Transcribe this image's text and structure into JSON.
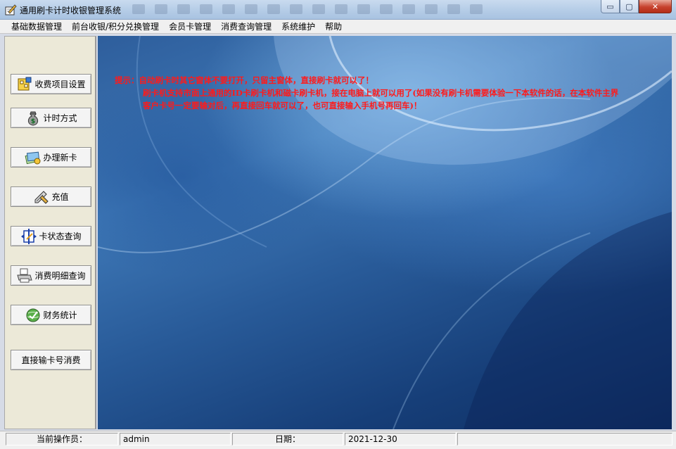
{
  "window": {
    "title": "通用刷卡计时收银管理系统",
    "controls": {
      "minimize": "▭",
      "maximize": "▢",
      "close": "✕"
    }
  },
  "menu": [
    "基础数据管理",
    "前台收银/积分兑换管理",
    "会员卡管理",
    "消费查询管理",
    "系统维护",
    "帮助"
  ],
  "sidebar": {
    "buttons": [
      {
        "label": "收费项目设置",
        "icon": "fee-settings-icon"
      },
      {
        "label": "计时方式",
        "icon": "money-bag-icon"
      },
      {
        "label": "办理新卡",
        "icon": "new-card-icon"
      },
      {
        "label": "充值",
        "icon": "recharge-pen-icon"
      },
      {
        "label": "卡状态查询",
        "icon": "card-status-icon"
      },
      {
        "label": "消费明细查询",
        "icon": "printer-icon"
      },
      {
        "label": "财务统计",
        "icon": "finance-globe-icon"
      },
      {
        "label": "直接输卡号消费",
        "icon": ""
      }
    ]
  },
  "notice": {
    "line1": "提示：自动刷卡时其它窗体不要打开，只留主窗体，直接刷卡就可以了！",
    "line2": "刷卡机支持市面上通用的ID卡刷卡机和磁卡刷卡机，接在电脑上就可以用了(如果没有刷卡机需要体验一下本软件的话，在本软件主界",
    "line3": "客户卡号一定要输对后，再直接回车就可以了，也可直接输入手机号再回车)！",
    "color": "#ff1a1a"
  },
  "statusbar": {
    "operator_label": "当前操作员：",
    "operator_value": "admin",
    "date_label": "日期：",
    "date_value": "2021-12-30"
  }
}
